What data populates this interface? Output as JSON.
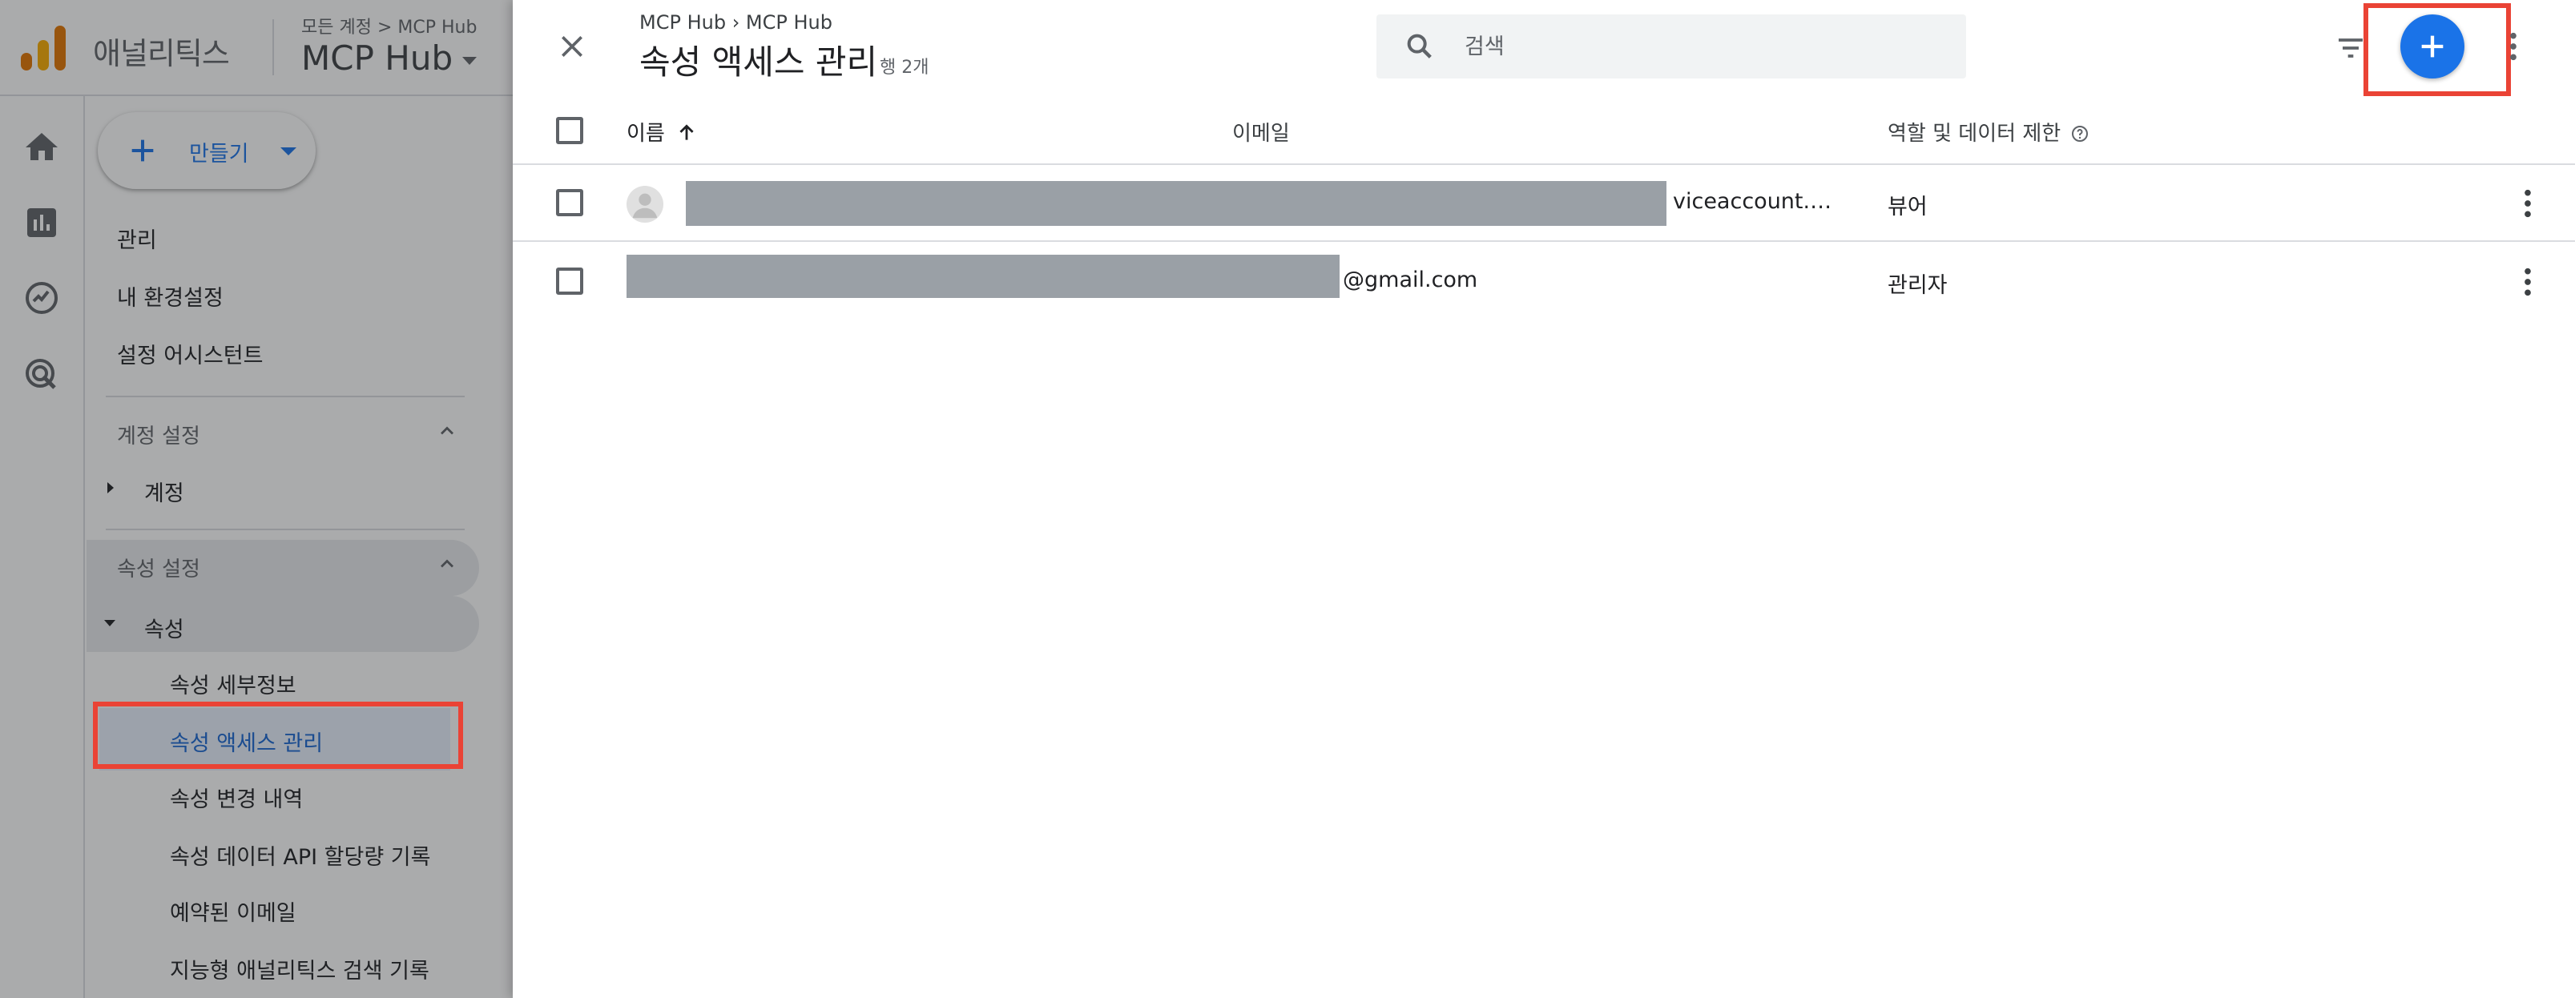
{
  "app": {
    "name": "애널리틱스",
    "account_breadcrumb": "모든 계정 > MCP Hub",
    "property_name": "MCP Hub"
  },
  "rail": {
    "icons": [
      "home-icon",
      "reports-icon",
      "explore-icon",
      "advertising-icon"
    ]
  },
  "sidebar": {
    "create_label": "만들기",
    "items": [
      "관리",
      "내 환경설정",
      "설정 어시스턴트"
    ],
    "account_section": {
      "heading": "계정 설정",
      "items": [
        "계정"
      ]
    },
    "property_section": {
      "heading": "속성 설정",
      "group_label": "속성",
      "sub_items": [
        "속성 세부정보",
        "속성 액세스 관리",
        "속성 변경 내역",
        "속성 데이터 API 할당량 기록",
        "예약된 이메일",
        "지능형 애널리틱스 검색 기록"
      ],
      "active_item": "속성 액세스 관리"
    }
  },
  "panel": {
    "breadcrumb": "MCP Hub › MCP Hub",
    "title": "속성 액세스 관리",
    "row_count": "행 2개",
    "search_placeholder": "검색",
    "columns": {
      "name": "이름",
      "email": "이메일",
      "role": "역할 및 데이터 제한"
    },
    "sort": "name-ascending",
    "rows": [
      {
        "email_visible": "viceaccount.…",
        "role": "뷰어",
        "has_avatar": true
      },
      {
        "email_visible": "@gmail.com",
        "role": "관리자",
        "has_avatar": false
      }
    ]
  },
  "colors": {
    "accent_blue": "#1a73e8",
    "highlight_red": "#ea4335",
    "active_nav_bg": "#e8f0fe",
    "redaction_gray": "#9aa0a6"
  }
}
